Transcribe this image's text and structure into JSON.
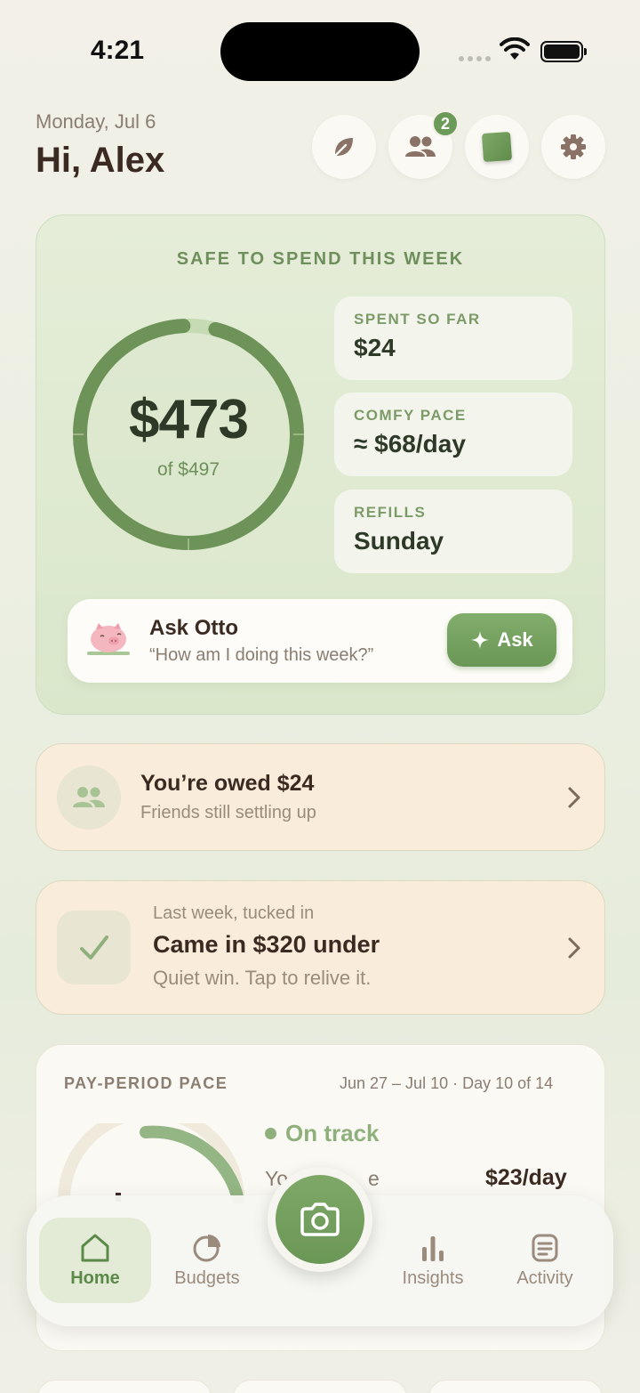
{
  "status_bar": {
    "time": "4:21"
  },
  "header": {
    "date": "Monday, Jul 6",
    "greeting": "Hi, Alex",
    "buttons": [
      {
        "icon": "leaf-icon"
      },
      {
        "icon": "friends-icon",
        "badge": "2"
      },
      {
        "icon": "green-square-icon"
      },
      {
        "icon": "gear-icon"
      }
    ]
  },
  "safe_to_spend": {
    "title": "SAFE TO SPEND THIS WEEK",
    "amount": "$473",
    "of_total": "of $497",
    "remaining_fraction": 0.952,
    "stats": [
      {
        "label": "SPENT SO FAR",
        "value": "$24"
      },
      {
        "label": "COMFY PACE",
        "value": "≈ $68/day"
      },
      {
        "label": "REFILLS",
        "value": "Sunday"
      }
    ]
  },
  "ask_otto": {
    "title": "Ask Otto",
    "prompt": "“How am I doing this week?”",
    "button_label": "Ask"
  },
  "owed": {
    "title": "You’re owed $24",
    "subtitle": "Friends still settling up"
  },
  "last_week": {
    "kicker": "Last week, tucked in",
    "title": "Came in $320 under",
    "subtitle": "Quiet win. Tap to relive it."
  },
  "pay_period": {
    "label": "PAY-PERIOD PACE",
    "range": "Jun 27 – Jul 10 · Day 10 of 14",
    "status": "On track",
    "row_label_visible": "Yo",
    "row_label_tail": "e",
    "row_value": "$23/day"
  },
  "nav": {
    "items": [
      {
        "label": "Home",
        "icon": "home-icon",
        "active": true
      },
      {
        "label": "Budgets",
        "icon": "pie-chart-icon"
      },
      {
        "label": "Insights",
        "icon": "bar-chart-icon"
      },
      {
        "label": "Activity",
        "icon": "list-icon"
      }
    ],
    "center_button_icon": "camera-icon"
  },
  "colors": {
    "accent_green": "#6a9656",
    "ring_green": "#6e9358",
    "ring_track": "#c6dab4",
    "warm_card": "#f9ecda",
    "text_dark": "#3b2a22"
  }
}
